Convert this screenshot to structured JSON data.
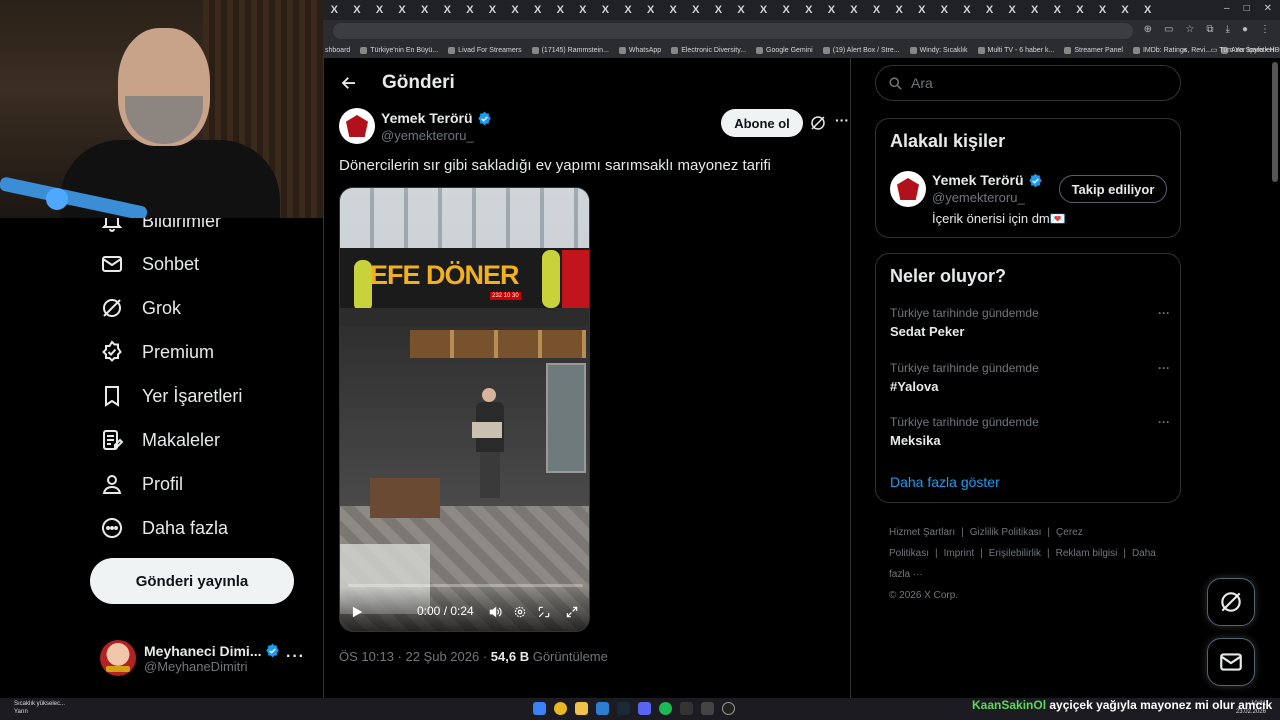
{
  "browser": {
    "tab_glyph": "X",
    "tab_count": 37,
    "window_controls": [
      "–",
      "□",
      "✕"
    ],
    "bookmarks": [
      "shboard",
      "Türkiye'nin En Büyü...",
      "Livad For Streamers",
      "(17145) Rammstein...",
      "WhatsApp",
      "Electronic Diversity...",
      "Google Gemini",
      "(19) Alert Box / Stre...",
      "Windy: Sıcaklık",
      "Multi TV - 6 haber k...",
      "Streamer Panel",
      "IMDb: Ratings, Revi...",
      "Ana Sayfa • HBO Max"
    ],
    "bookmarks_more": "»",
    "bookmarks_all": "Tüm Yer İşaretleri"
  },
  "nav": {
    "items": [
      {
        "label": "Bildirimler",
        "icon": "bell-icon"
      },
      {
        "label": "Sohbet",
        "icon": "mail-icon"
      },
      {
        "label": "Grok",
        "icon": "grok-icon"
      },
      {
        "label": "Premium",
        "icon": "premium-badge-icon"
      },
      {
        "label": "Yer İşaretleri",
        "icon": "bookmark-icon"
      },
      {
        "label": "Makaleler",
        "icon": "article-icon"
      },
      {
        "label": "Profil",
        "icon": "person-icon"
      },
      {
        "label": "Daha fazla",
        "icon": "more-circle-icon"
      }
    ],
    "post_button": "Gönderi yayınla"
  },
  "account": {
    "name": "Meyhaneci Dimi...",
    "handle": "@MeyhaneDimitri",
    "more": "···"
  },
  "main": {
    "title": "Gönderi",
    "tweet": {
      "author_name": "Yemek Terörü",
      "author_handle": "@yemekteroru_",
      "subscribe_label": "Abone ol",
      "more": "···",
      "text": "Dönercilerin sır gibi sakladığı ev yapımı sarımsaklı mayonez tarifi",
      "media": {
        "sign_text": "EFE DÖNER",
        "sign_phone": "232 10 30",
        "time": "0:00 / 0:24",
        "progress": 0
      },
      "meta_time": "ÖS 10:13 · 22 Şub 2026 · ",
      "views_count": "54,6 B",
      "views_label": " Görüntüleme"
    }
  },
  "right": {
    "search_placeholder": "Ara",
    "related": {
      "title": "Alakalı kişiler",
      "name": "Yemek Terörü",
      "handle": "@yemekteroru_",
      "bio": "İçerik önerisi için dm💌",
      "follow_label": "Takip ediliyor"
    },
    "trends": {
      "title": "Neler oluyor?",
      "items": [
        {
          "context": "Türkiye tarihinde gündemde",
          "topic": "Sedat Peker"
        },
        {
          "context": "Türkiye tarihinde gündemde",
          "topic": "#Yalova"
        },
        {
          "context": "Türkiye tarihinde gündemde",
          "topic": "Meksika"
        }
      ],
      "show_more": "Daha fazla göster",
      "dots": "···"
    },
    "footer": {
      "links": [
        "Hizmet Şartları",
        "|",
        "Gizlilik Politikası",
        "|",
        "Çerez Politikası",
        "|",
        "Imprint",
        "|",
        "Erişilebilirlik",
        "|",
        "Reklam bilgisi",
        "|",
        "Daha fazla ···"
      ],
      "copyright": "© 2026 X Corp."
    }
  },
  "taskbar": {
    "weather_line1": "Sıcaklık yükselec...",
    "weather_line2": "Yarın",
    "clock_time": "10:31",
    "clock_date": "23.02.2026"
  },
  "chat": {
    "user": "KaanSakinOl",
    "message": "ayçiçek yağıyla mayonez mi olur amcık"
  },
  "colors": {
    "accent": "#1d9bf0",
    "verified": "#1d9bf0",
    "background": "#000000",
    "border": "#2f3336",
    "muted": "#71767b",
    "chat_user": "#5cd65c"
  }
}
